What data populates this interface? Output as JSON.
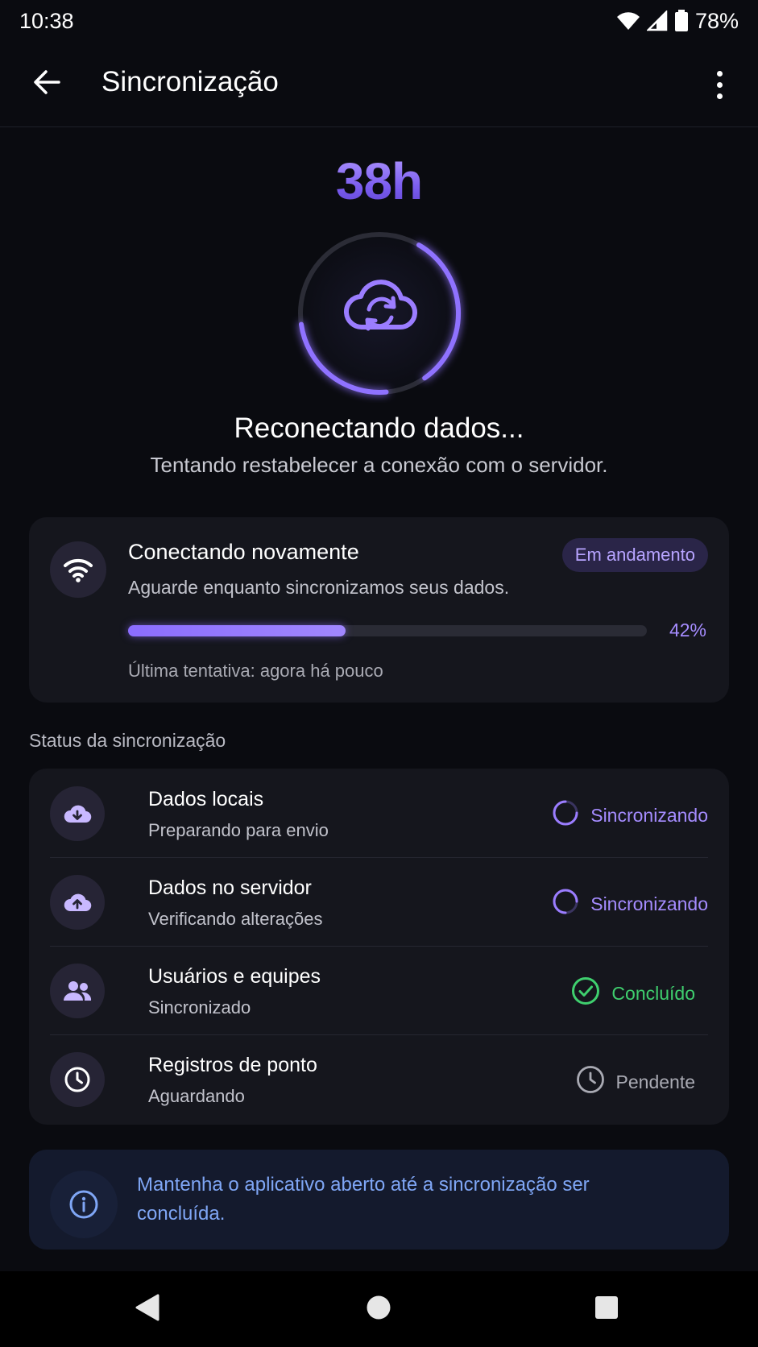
{
  "status_bar": {
    "time": "10:38",
    "battery": "78%",
    "icons": [
      "wifi-icon",
      "signal-icon",
      "battery-icon"
    ]
  },
  "app_bar": {
    "title": "Sincronização",
    "back_icon": "arrow-left-icon",
    "menu_icon": "more-vert-icon"
  },
  "hero": {
    "timer": "38h",
    "icon": "cloud-sync-icon",
    "ring_progress": 0.42,
    "title": "Reconectando dados...",
    "subtitle": "Tentando restabelecer a conexão com o servidor."
  },
  "connection": {
    "icon": "wifi-icon",
    "title": "Conectando novamente",
    "subtitle": "Aguarde enquanto sincronizamos seus dados.",
    "badge": "Em andamento",
    "progress": 0.42,
    "progress_label": "42%",
    "last_attempt": "Última tentativa: agora há pouco"
  },
  "section_title": "Status da sincronização",
  "items": [
    {
      "icon": "cloud-download-icon",
      "title": "Dados locais",
      "subtitle": "Preparando para envio",
      "status": "Sincronizando",
      "status_icon": "spinner-icon",
      "status_color": "#a58cff"
    },
    {
      "icon": "cloud-upload-icon",
      "title": "Dados no servidor",
      "subtitle": "Verificando alterações",
      "status": "Sincronizando",
      "status_icon": "spinner-icon",
      "status_color": "#a58cff"
    },
    {
      "icon": "people-icon",
      "title": "Usuários e equipes",
      "subtitle": "Sincronizado",
      "status": "Concluído",
      "status_icon": "check-circle-icon",
      "status_color": "#3fcf6e"
    },
    {
      "icon": "clock-icon",
      "title": "Registros de ponto",
      "subtitle": "Aguardando",
      "status": "Pendente",
      "status_icon": "clock-outline-icon",
      "status_color": "#a9aab3"
    }
  ],
  "info": {
    "icon": "info-icon",
    "text": "Mantenha o aplicativo aberto até a sincronização ser concluída."
  },
  "nav": {
    "back_icon": "nav-back-icon",
    "home_icon": "nav-home-icon",
    "recents_icon": "nav-recents-icon"
  },
  "colors": {
    "accent": "#8b6dff",
    "success": "#3fcf6e",
    "info": "#7fa6f5",
    "background": "#0a0b10",
    "card": "#15161d"
  }
}
